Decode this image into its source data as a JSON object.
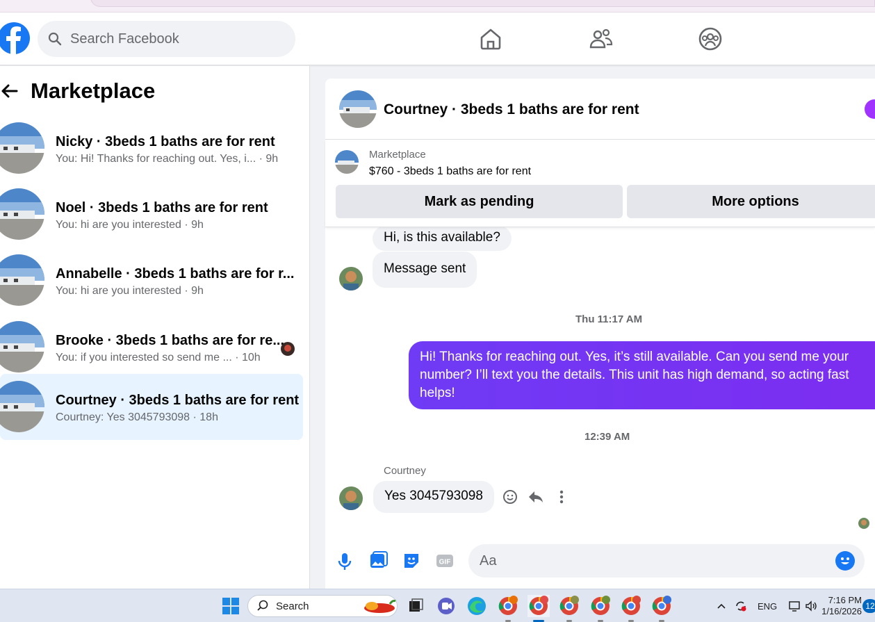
{
  "colors": {
    "fb_blue": "#1877f2",
    "outgoing_bubble": "#6f3bf5",
    "active_row": "#e7f3ff",
    "incoming_bubble": "#f0f2f5"
  },
  "header": {
    "search_placeholder": "Search Facebook",
    "icons": [
      "facebook-logo-icon",
      "search-icon",
      "home-icon",
      "friends-icon",
      "groups-icon"
    ]
  },
  "sidebar": {
    "title": "Marketplace",
    "conversations": [
      {
        "name": "Nicky · 3beds 1 baths are for rent",
        "preview": "You: Hi! Thanks for reaching out. Yes, i... · 9h",
        "active": false
      },
      {
        "name": "Noel · 3beds 1 baths are for rent",
        "preview": "You: hi are you interested · 9h",
        "active": false
      },
      {
        "name": "Annabelle · 3beds 1 baths are for r...",
        "preview": "You: hi are you interested · 9h",
        "active": false
      },
      {
        "name": "Brooke · 3beds 1 baths are for re...",
        "preview": "You: if you interested so send me ... · 10h",
        "active": false
      },
      {
        "name": "Courtney · 3beds 1 baths are for rent",
        "preview": "Courtney: Yes 3045793098 · 18h",
        "active": true
      }
    ]
  },
  "chat": {
    "title": "Courtney · 3beds 1 baths are for rent",
    "listing": {
      "kind": "Marketplace",
      "price_title": "$760 - 3beds 1 baths are for rent",
      "mark_pending_label": "Mark as pending",
      "more_options_label": "More options"
    },
    "messages": {
      "incoming_1": "Hi, is this available?",
      "incoming_2": "Message sent",
      "time_1": "Thu 11:17 AM",
      "outgoing_1": "Hi! Thanks for reaching out. Yes, it’s still available. Can you send me your number? I’ll text you the details. This unit has high demand, so acting fast helps!",
      "time_2": "12:39 AM",
      "sender_name": "Courtney",
      "incoming_3": "Yes 3045793098"
    },
    "composer": {
      "placeholder": "Aa"
    }
  },
  "taskbar": {
    "search_label": "Search",
    "tray_lang": "ENG",
    "time": "7:16 PM",
    "date": "1/16/2026",
    "notification_count": "12"
  }
}
